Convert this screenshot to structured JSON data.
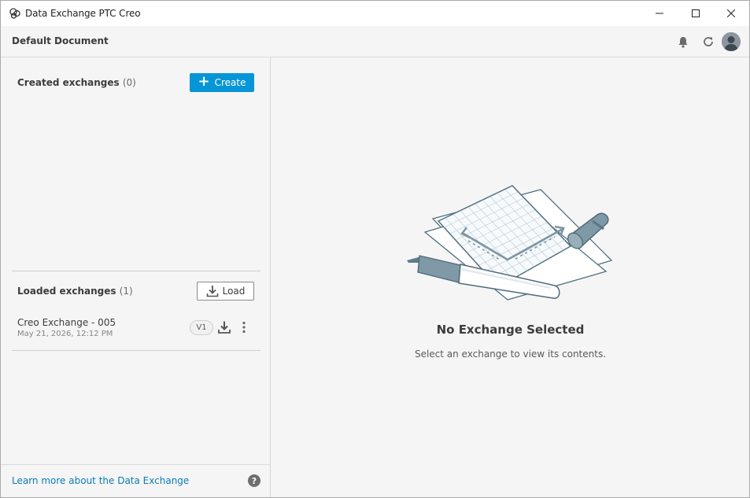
{
  "window": {
    "title": "Data Exchange PTC Creo",
    "controls": [
      "minimize-icon",
      "maximize-icon",
      "close-icon"
    ]
  },
  "header": {
    "document_title": "Default Document",
    "icons": [
      "bell-icon",
      "refresh-icon",
      "avatar"
    ]
  },
  "left_panel": {
    "created": {
      "title": "Created exchanges",
      "count": "(0)",
      "create_label": "Create"
    },
    "loaded": {
      "title": "Loaded exchanges",
      "count": "(1)",
      "load_label": "Load",
      "items": [
        {
          "name": "Creo Exchange - 005",
          "date": "May 21, 2026, 12:12 PM",
          "version": "V1"
        }
      ]
    },
    "footer": {
      "learn_more": "Learn more about the Data Exchange",
      "help_icon": "?"
    }
  },
  "right_panel": {
    "empty_title": "No Exchange Selected",
    "empty_subtitle": "Select an exchange to view its contents."
  },
  "colors": {
    "accent": "#0696d7",
    "link": "#0b7bb8",
    "background": "#f5f5f5"
  }
}
